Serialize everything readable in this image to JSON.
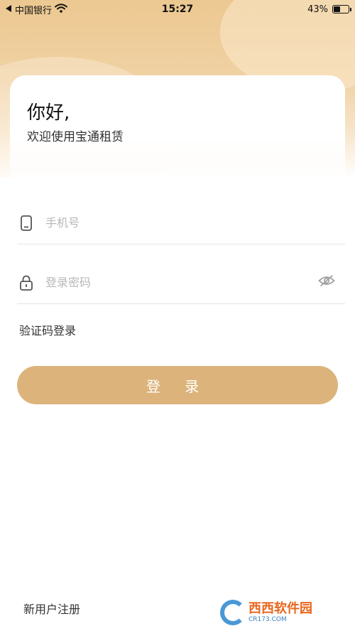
{
  "status_bar": {
    "carrier": "中国银行",
    "time": "15:27",
    "battery": "43%",
    "battery_level": 0.43
  },
  "welcome": {
    "title": "你好,",
    "subtitle": "欢迎使用宝通租赁"
  },
  "form": {
    "phone_placeholder": "手机号",
    "password_placeholder": "登录密码",
    "sms_login_label": "验证码登录",
    "login_button": "登 录"
  },
  "footer": {
    "register_label": "新用户注册"
  },
  "watermark": {
    "text": "西西软件园",
    "url": "CR173.COM"
  },
  "colors": {
    "accent": "#dcb47b",
    "header": "#ecc891"
  },
  "icons": {
    "phone": "phone-icon",
    "lock": "lock-icon",
    "eye": "eye-hidden-icon",
    "wifi": "wifi-icon",
    "back": "back-arrow-icon",
    "battery": "battery-icon"
  }
}
